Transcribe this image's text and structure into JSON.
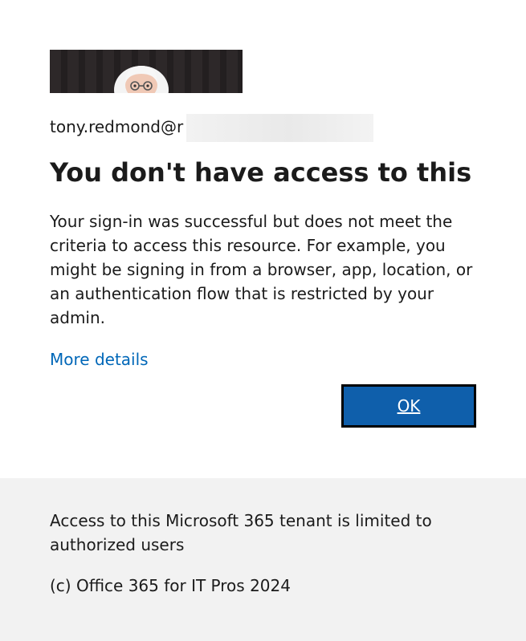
{
  "account": {
    "username": "tony.redmond@r"
  },
  "error": {
    "title": "You don't have access to this",
    "description": "Your sign-in was successful but does not meet the criteria to access this resource. For example, you might be signing in from a browser, app, location, or an authentication flow that is restricted by your admin.",
    "more_details_link": "More details"
  },
  "actions": {
    "ok_label": "OK"
  },
  "footer": {
    "notice": "Access to this Microsoft 365 tenant is limited to authorized users",
    "copyright": "(c) Office 365 for IT Pros 2024"
  },
  "colors": {
    "link": "#0067b8",
    "primary_button": "#0f5fab",
    "footer_background": "#f2f2f2",
    "banner_background": "#2a2627"
  },
  "icons": {
    "banner_avatar": "user-avatar-icon"
  }
}
